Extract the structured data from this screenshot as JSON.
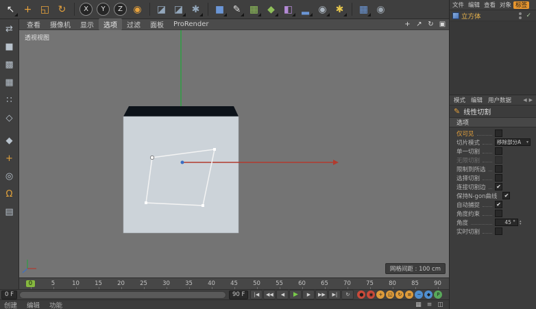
{
  "top_toolbar": {
    "icons": [
      {
        "name": "live-selection-tool",
        "glyph": "↖",
        "color": "#ececec",
        "dd": true
      },
      {
        "name": "move-tool",
        "glyph": "+",
        "color": "#e8a33d"
      },
      {
        "name": "scale-tool",
        "glyph": "◱",
        "color": "#e8a33d"
      },
      {
        "name": "rotate-tool",
        "glyph": "↻",
        "color": "#e8a33d",
        "gend": true
      },
      {
        "name": "lock-x-axis-button",
        "glyph": "X",
        "circle": true
      },
      {
        "name": "lock-y-axis-button",
        "glyph": "Y",
        "circle": true
      },
      {
        "name": "lock-z-axis-button",
        "glyph": "Z",
        "circle": true
      },
      {
        "name": "coordinate-system-button",
        "glyph": "◉",
        "color": "#e8a33d",
        "gend": true
      },
      {
        "name": "render-view-button",
        "glyph": "◪",
        "color": "#93a7bb"
      },
      {
        "name": "render-picture-viewer-button",
        "glyph": "◪",
        "color": "#93a7bb",
        "dd": true
      },
      {
        "name": "render-settings-button",
        "glyph": "✱",
        "color": "#93a7bb",
        "dd": true,
        "gend": true
      },
      {
        "name": "add-cube-button",
        "glyph": "■",
        "color": "#6b96d6",
        "dd": true
      },
      {
        "name": "add-spline-button",
        "glyph": "✎",
        "color": "#dcdcdc",
        "dd": true
      },
      {
        "name": "subdivision-surface-button",
        "glyph": "▦",
        "color": "#8fbf5a",
        "dd": true
      },
      {
        "name": "array-generator-button",
        "glyph": "◆",
        "color": "#8fbf5a",
        "dd": true
      },
      {
        "name": "deformer-button",
        "glyph": "◧",
        "color": "#b48ad6",
        "dd": true
      },
      {
        "name": "environment-button",
        "glyph": "▂",
        "color": "#6b96d6",
        "dd": true
      },
      {
        "name": "camera-button",
        "glyph": "◉",
        "color": "#aab4be",
        "dd": true
      },
      {
        "name": "light-button",
        "glyph": "✱",
        "color": "#e8c84d",
        "dd": true,
        "gend": true
      },
      {
        "name": "display-filter-button",
        "glyph": "▦",
        "color": "#6b96d6",
        "dd": true
      },
      {
        "name": "film-camera-button",
        "glyph": "◉",
        "color": "#9aa4ae"
      }
    ]
  },
  "left_toolbar": {
    "icons": [
      {
        "name": "make-editable-icon",
        "glyph": "⇄",
        "color": "#b8c2cc"
      },
      {
        "name": "model-mode-icon",
        "glyph": "■",
        "color": "#b8c2cc"
      },
      {
        "name": "texture-mode-icon",
        "glyph": "▩",
        "color": "#b8c2cc"
      },
      {
        "name": "workplane-mode-icon",
        "glyph": "▦",
        "color": "#b8c2cc"
      },
      {
        "name": "points-mode-icon",
        "glyph": "∷",
        "color": "#b8c2cc"
      },
      {
        "name": "edges-mode-icon",
        "glyph": "◇",
        "color": "#b8c2cc",
        "gend": true
      },
      {
        "name": "polygons-mode-icon",
        "glyph": "◆",
        "color": "#b8c2cc"
      },
      {
        "name": "enable-axis-icon",
        "glyph": "+",
        "color": "#e0a23c"
      },
      {
        "name": "viewport-solo-icon",
        "glyph": "◎",
        "color": "#b8c2cc"
      },
      {
        "name": "snap-magnet-icon",
        "glyph": "Ω",
        "color": "#e0a23c"
      },
      {
        "name": "workplane-snap-icon",
        "glyph": "▤",
        "color": "#b8c2cc"
      }
    ]
  },
  "viewport": {
    "menu": [
      {
        "name": "vp-menu-view",
        "label": "查看"
      },
      {
        "name": "vp-menu-camera",
        "label": "摄像机"
      },
      {
        "name": "vp-menu-display",
        "label": "显示"
      },
      {
        "name": "vp-menu-options",
        "label": "选项",
        "active": true
      },
      {
        "name": "vp-menu-filter",
        "label": "过滤"
      },
      {
        "name": "vp-menu-panel",
        "label": "面板"
      },
      {
        "name": "vp-menu-prorender",
        "label": "ProRender"
      }
    ],
    "nav_icons": [
      {
        "name": "pan-view-icon",
        "glyph": "+"
      },
      {
        "name": "dolly-view-icon",
        "glyph": "↗"
      },
      {
        "name": "rotate-view-icon",
        "glyph": "↻"
      },
      {
        "name": "toggle-view-icon",
        "glyph": "▣"
      }
    ],
    "view_label": "透视视图",
    "grid_spacing_label": "网格间距 : 100 cm",
    "colors": {
      "cube_face": "#ccd3d9",
      "cube_top": "#0d131a",
      "axis_x": "#b23b2e",
      "axis_y": "#2f9e43",
      "axis_z": "#3b6fc4",
      "cut_stroke": "#f4f4f4"
    }
  },
  "object_manager": {
    "menu": [
      {
        "name": "om-menu-file",
        "label": "文件"
      },
      {
        "name": "om-menu-edit",
        "label": "编辑"
      },
      {
        "name": "om-menu-view",
        "label": "查看"
      },
      {
        "name": "om-menu-object",
        "label": "对象"
      },
      {
        "name": "om-menu-tags",
        "label": "标签",
        "active": true
      }
    ],
    "object": {
      "label": "立方体"
    },
    "enabled_mark": "✓"
  },
  "attribute_manager": {
    "menu": [
      {
        "name": "am-menu-mode",
        "label": "模式"
      },
      {
        "name": "am-menu-edit",
        "label": "编辑"
      },
      {
        "name": "am-menu-userdata",
        "label": "用户数据"
      }
    ],
    "nav_icons": [
      {
        "name": "history-back-icon",
        "glyph": "◀"
      },
      {
        "name": "history-forward-icon",
        "glyph": "▶"
      }
    ],
    "tool_name": "线性切割",
    "section_label": "选项",
    "rows": [
      {
        "name": "option-only-visible",
        "label": "仅可见",
        "is_check": true,
        "checked": false,
        "accent": true
      },
      {
        "name": "option-slice-mode",
        "label": "切片模式",
        "is_drop": true,
        "value": "移除部分A"
      },
      {
        "name": "option-single-cut",
        "label": "单一切割",
        "is_check": true,
        "checked": false
      },
      {
        "name": "option-infinite-cut",
        "label": "无限切割",
        "is_check": true,
        "checked": false,
        "dim": true
      },
      {
        "name": "option-restrict-to-selection",
        "label": "限制到所选",
        "is_check": true,
        "checked": false
      },
      {
        "name": "option-select-cuts",
        "label": "选择切割",
        "is_check": true,
        "checked": false
      },
      {
        "name": "option-connect-cut-edges",
        "label": "连接切割边",
        "is_check": true,
        "checked": true
      },
      {
        "name": "option-preserve-ngon-curvature",
        "label": "保持N-gon曲线",
        "is_check": true,
        "checked": true
      },
      {
        "name": "option-auto-snap",
        "label": "自动捕捉",
        "is_check": true,
        "checked": true
      },
      {
        "name": "option-angle-constrain",
        "label": "角度约束",
        "is_check": true,
        "checked": false
      },
      {
        "name": "option-angle",
        "label": "角度",
        "is_num": true,
        "value": "45 °"
      },
      {
        "name": "option-realtime-cut",
        "label": "实时切割",
        "is_check": true,
        "checked": false
      }
    ]
  },
  "timeline": {
    "ticks": [
      {
        "label": "0",
        "current": true
      },
      {
        "label": "5"
      },
      {
        "label": "10"
      },
      {
        "label": "15"
      },
      {
        "label": "20"
      },
      {
        "label": "25"
      },
      {
        "label": "30"
      },
      {
        "label": "35"
      },
      {
        "label": "40"
      },
      {
        "label": "45"
      },
      {
        "label": "50"
      },
      {
        "label": "55"
      },
      {
        "label": "60"
      },
      {
        "label": "65"
      },
      {
        "label": "70"
      },
      {
        "label": "75"
      },
      {
        "label": "80"
      },
      {
        "label": "85"
      },
      {
        "label": "90"
      }
    ]
  },
  "transport": {
    "start_frame": "0 F",
    "end_frame": "90 F",
    "buttons": [
      {
        "name": "go-to-start-button",
        "glyph": "|◀"
      },
      {
        "name": "previous-key-button",
        "glyph": "◀◀"
      },
      {
        "name": "previous-frame-button",
        "glyph": "◀"
      },
      {
        "name": "play-button",
        "glyph": "▶",
        "play": true
      },
      {
        "name": "next-frame-button",
        "glyph": "▶"
      },
      {
        "name": "next-key-button",
        "glyph": "▶▶"
      },
      {
        "name": "go-to-end-button",
        "glyph": "▶|"
      },
      {
        "name": "loop-button",
        "glyph": "↻"
      }
    ],
    "record_buttons": [
      {
        "name": "record-keyframe-button",
        "glyph": "●",
        "color": "#c94a3a"
      },
      {
        "name": "autokey-button",
        "glyph": "◉",
        "color": "#c94a3a"
      },
      {
        "name": "record-position-button",
        "glyph": "+",
        "color": "#de9b3a"
      },
      {
        "name": "record-scale-button",
        "glyph": "◱",
        "color": "#de9b3a"
      },
      {
        "name": "record-rotation-button",
        "glyph": "↻",
        "color": "#de9b3a"
      },
      {
        "name": "record-parameter-button",
        "glyph": "≡",
        "color": "#de9b3a"
      },
      {
        "name": "record-pla-button",
        "glyph": "~",
        "color": "#4f8fd0"
      },
      {
        "name": "keyframe-selection-button",
        "glyph": "◆",
        "color": "#4f8fd0"
      },
      {
        "name": "keyframe-presets-button",
        "glyph": "P",
        "color": "#58a85a"
      }
    ]
  },
  "status_bar": {
    "menus": [
      {
        "name": "mat-menu-create",
        "label": "创建"
      },
      {
        "name": "mat-menu-edit",
        "label": "编辑"
      },
      {
        "name": "mat-menu-function",
        "label": "功能"
      }
    ],
    "icons": [
      {
        "name": "render-queue-icon",
        "glyph": "▦"
      },
      {
        "name": "console-icon",
        "glyph": "≡"
      },
      {
        "name": "layout-icon",
        "glyph": "◫"
      }
    ]
  }
}
